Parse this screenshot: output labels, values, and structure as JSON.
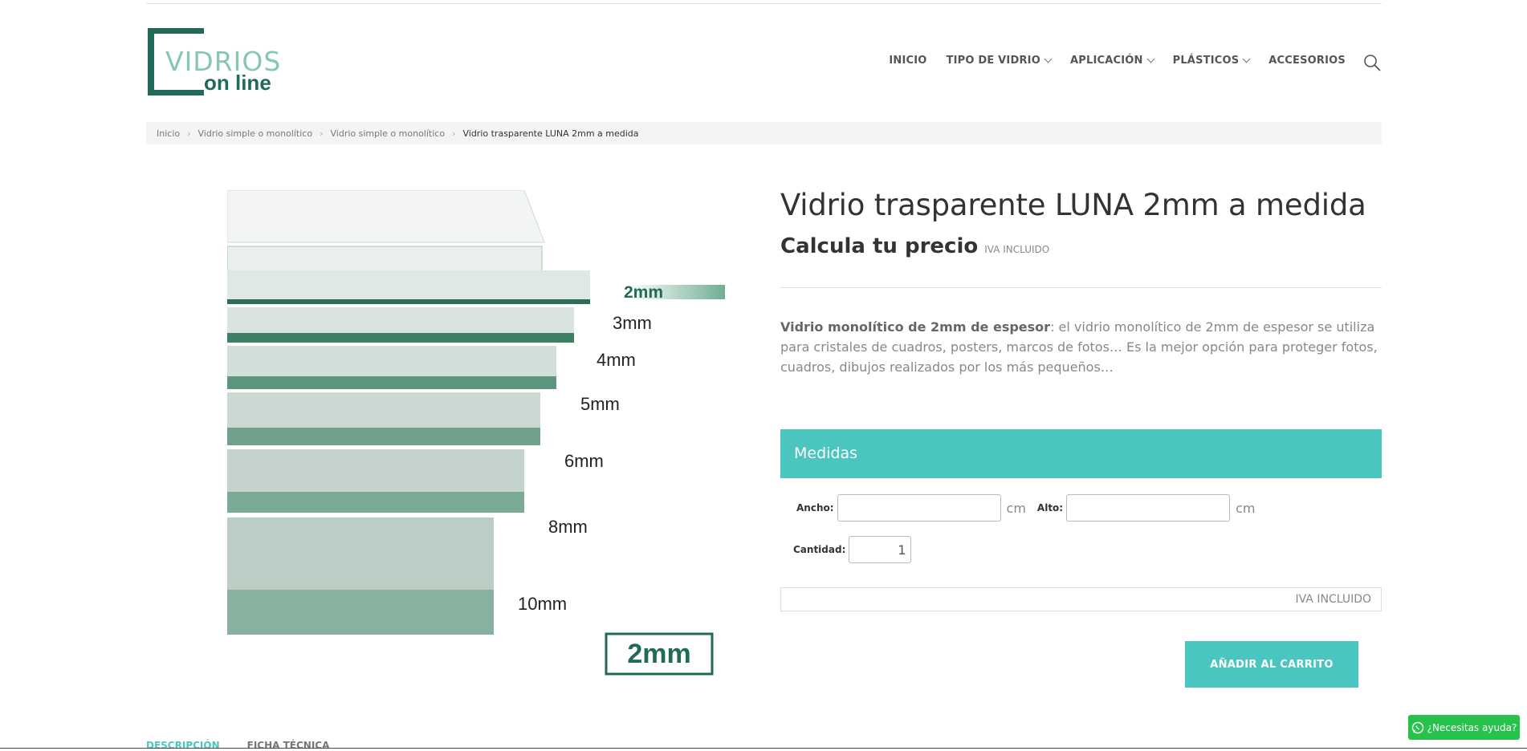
{
  "logo": {
    "line1": "VIDRIOS",
    "line2": "on line"
  },
  "nav": {
    "items": [
      {
        "label": "INICIO",
        "has_dropdown": false
      },
      {
        "label": "TIPO DE VIDRIO",
        "has_dropdown": true
      },
      {
        "label": "APLICACIÓN",
        "has_dropdown": true
      },
      {
        "label": "PLÁSTICOS",
        "has_dropdown": true
      },
      {
        "label": "ACCESORIOS",
        "has_dropdown": false
      }
    ],
    "search_icon": "search-icon"
  },
  "breadcrumb": {
    "items": [
      "Inicio",
      "Vidrio simple o monolítico",
      "Vidrio simple o monolítico"
    ],
    "current": "Vidrio trasparente LUNA 2mm a medida"
  },
  "product": {
    "title": "Vidrio trasparente LUNA 2mm a medida",
    "price_heading": "Calcula tu precio",
    "iva_note": "IVA INCLUIDO",
    "description_bold": "Vidrio monolítico de 2mm de espesor",
    "description_rest": ": el vidrio monolítico de 2mm de espesor se utiliza para cristales de cuadros, posters, marcos de fotos… Es la mejor opción para proteger fotos, cuadros, dibujos realizados por los más pequeños…",
    "image_labels": [
      "2mm",
      "3mm",
      "4mm",
      "5mm",
      "6mm",
      "8mm",
      "10mm"
    ],
    "image_badge": "2mm"
  },
  "form": {
    "section_title": "Medidas",
    "ancho_label": "Ancho:",
    "ancho_value": "",
    "alto_label": "Alto:",
    "alto_value": "",
    "unit": "cm",
    "cantidad_label": "Cantidad:",
    "cantidad_value": "1",
    "total_iva": "IVA INCLUIDO",
    "add_to_cart": "AÑADIR AL CARRITO"
  },
  "tabs": [
    "DESCRIPCIÓN",
    "FICHA TÉCNICA"
  ],
  "help_button": "¿Necesitas ayuda?",
  "colors": {
    "accent": "#4bc5bf",
    "logo_dark": "#1f6b57",
    "logo_light": "#86c7b3",
    "whatsapp": "#27c24c"
  }
}
